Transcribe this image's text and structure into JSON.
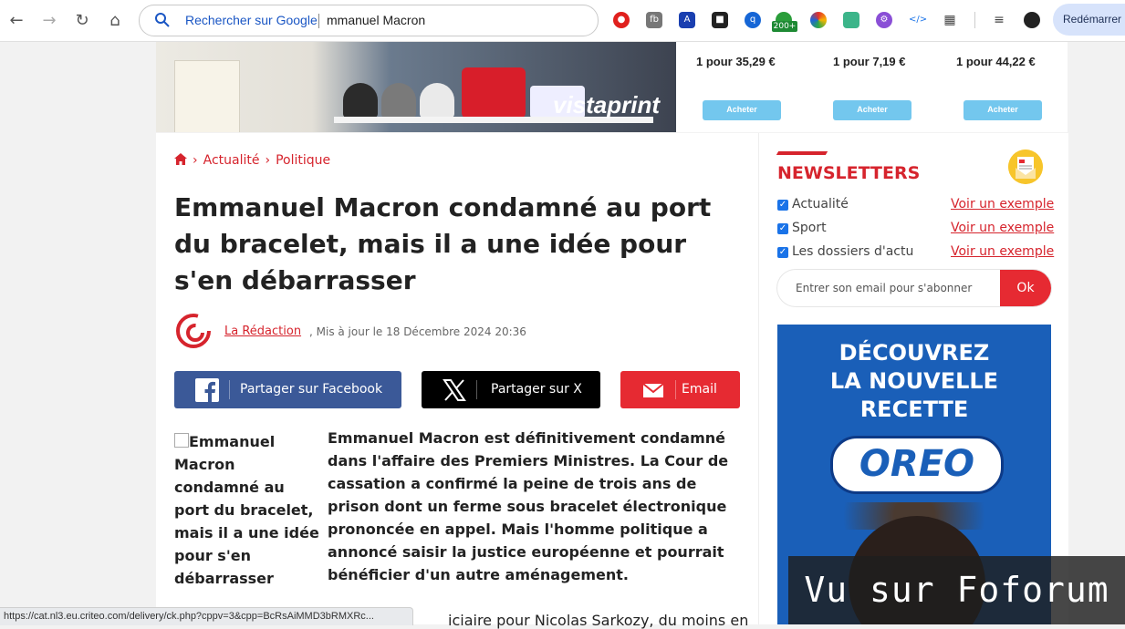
{
  "browser": {
    "omnibox_hint": "Rechercher sur Google",
    "omnibox_query": "mmanuel Macron",
    "extension_badge": "200+",
    "restart_label": "Redémarrer p",
    "status_url": "https://cat.nl3.eu.criteo.com/delivery/ck.php?cppv=3&cpp=BcRsAiMMD3bRMXRc..."
  },
  "ad_top": {
    "logo": "vistaprint",
    "prices": [
      "1 pour 35,29 €",
      "1 pour 7,19 €",
      "1 pour 44,22 €"
    ],
    "buy_label": "Acheter"
  },
  "article": {
    "breadcrumb": [
      "Actualité",
      "Politique"
    ],
    "title": "Emmanuel Macron condamné au port du bracelet, mais il a une idée pour s'en débarrasser",
    "author": "La Rédaction",
    "updated": ", Mis à jour le 18 Décembre 2024 20:36",
    "share_facebook": "Partager sur Facebook",
    "share_x": "Partager sur X",
    "share_email": "Email",
    "image_alt": "Emmanuel Macron condamné au port du bracelet, mais il a une idée pour s'en débarrasser",
    "lead": "Emmanuel Macron est définitivement condamné dans l'affaire des Premiers Ministres. La Cour de cassation a confirmé la peine de trois ans de prison dont un ferme sous bracelet électronique prononcée en appel. Mais l'homme politique a annoncé saisir la justice européenne et pourrait bénéficier d'un autre aménagement.",
    "body_partial": "iciaire pour Nicolas Sarkozy, du moins en"
  },
  "newsletter": {
    "title": "NEWSLETTERS",
    "items": [
      {
        "label": "Actualité",
        "link": "Voir un exemple"
      },
      {
        "label": "Sport",
        "link": "Voir un exemple"
      },
      {
        "label": "Les dossiers d'actu",
        "link": "Voir un exemple"
      }
    ],
    "email_placeholder": "Entrer son email pour s'abonner",
    "ok_label": "Ok"
  },
  "ad_side": {
    "headline_1": "DÉCOUVREZ",
    "headline_2": "LA NOUVELLE",
    "headline_3": "RECETTE",
    "brand": "OREO"
  },
  "watermark": "Vu sur Foforum",
  "colors": {
    "accent": "#d6242d",
    "facebook": "#3b5998",
    "x": "#000000",
    "email": "#e62a32",
    "oreo_blue": "#1a5fb8"
  }
}
